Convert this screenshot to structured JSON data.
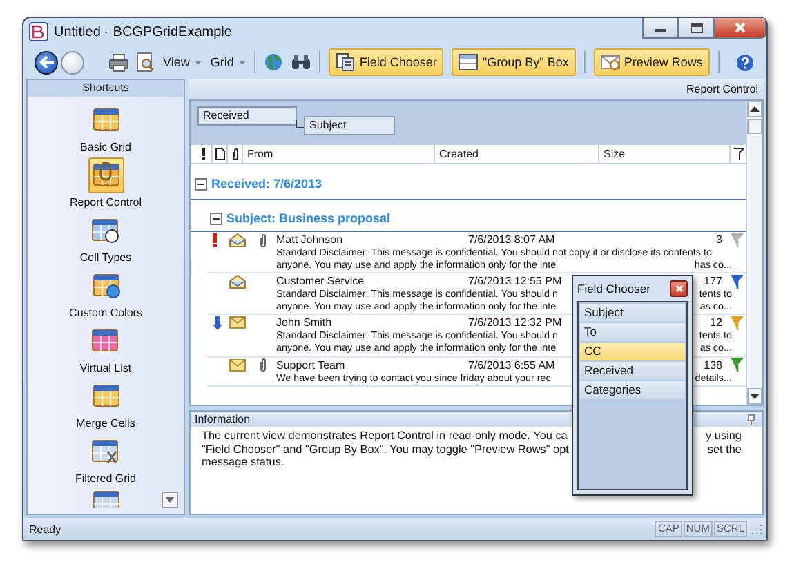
{
  "window": {
    "title": "Untitled - BCGPGridExample"
  },
  "toolbar": {
    "menus": [
      "View",
      "Grid"
    ],
    "toggles": [
      {
        "label": "Field Chooser",
        "checked": true
      },
      {
        "label": "\"Group By\" Box",
        "checked": true
      },
      {
        "label": "Preview Rows",
        "checked": true
      }
    ]
  },
  "sidebar": {
    "title": "Shortcuts",
    "items": [
      {
        "label": "Basic Grid",
        "selected": false
      },
      {
        "label": "Report Control",
        "selected": true
      },
      {
        "label": "Cell Types",
        "selected": false
      },
      {
        "label": "Custom Colors",
        "selected": false
      },
      {
        "label": "Virtual List",
        "selected": false
      },
      {
        "label": "Merge Cells",
        "selected": false
      },
      {
        "label": "Filtered Grid",
        "selected": false
      }
    ]
  },
  "report": {
    "title": "Report Control",
    "group_by": [
      "Received",
      "Subject"
    ],
    "columns": [
      "From",
      "Created",
      "Size"
    ],
    "groups": [
      {
        "label": "Received: 7/6/2013",
        "expanded": true,
        "children": [
          {
            "label": "Subject: Business proposal",
            "expanded": true,
            "rows": [
              {
                "high_importance": true,
                "low_importance": false,
                "read": true,
                "attachment": true,
                "from": "Matt Johnson",
                "created": "7/6/2013 8:07 AM",
                "size": "3",
                "color": "#b4b4b4",
                "preview": [
                  {
                    "left": "Standard Disclaimer: This message is confidential. You should not copy it or disclose its contents to"
                  },
                  {
                    "left": "anyone. You may use and apply the information only for the inte",
                    "right": "has co..."
                  }
                ]
              },
              {
                "high_importance": false,
                "low_importance": false,
                "read": true,
                "attachment": false,
                "from": "Customer Service",
                "created": "7/6/2013 12:55 PM",
                "size": "177",
                "color": "#2a5fd0",
                "preview": [
                  {
                    "left": "Standard Disclaimer: This message is confidential. You should n",
                    "right": "tents to"
                  },
                  {
                    "left": "anyone. You may use and apply the information only for the inte",
                    "right": "as co..."
                  }
                ]
              },
              {
                "high_importance": false,
                "low_importance": true,
                "read": false,
                "attachment": false,
                "from": "John Smith",
                "created": "7/6/2013 12:32 PM",
                "size": "12",
                "color": "#e0a020",
                "preview": [
                  {
                    "left": "Standard Disclaimer: This message is confidential. You should n",
                    "right": "tents to"
                  },
                  {
                    "left": "anyone. You may use and apply the information only for the inte",
                    "right": "as co..."
                  }
                ]
              },
              {
                "high_importance": false,
                "low_importance": false,
                "read": false,
                "attachment": true,
                "from": "Support Team",
                "created": "7/6/2013 6:55 AM",
                "size": "138",
                "color": "#3a9a2a",
                "preview": [
                  {
                    "left": "We have been trying to contact you since friday about your rec",
                    "right": "details..."
                  }
                ]
              }
            ]
          }
        ]
      }
    ]
  },
  "information": {
    "title": "Information",
    "lines": [
      {
        "left": "The current view demonstrates Report Control in read-only mode. You ca",
        "right": "y using"
      },
      {
        "left": "\"Field Chooser\" and \"Group By Box\".  You may toggle \"Preview Rows\" opt",
        "right": "set the"
      },
      {
        "left": "message status."
      }
    ]
  },
  "field_chooser": {
    "title": "Field Chooser",
    "fields": [
      {
        "label": "Subject",
        "selected": false
      },
      {
        "label": "To",
        "selected": false
      },
      {
        "label": "CC",
        "selected": true
      },
      {
        "label": "Received",
        "selected": false
      },
      {
        "label": "Categories",
        "selected": false
      }
    ]
  },
  "status_bar": {
    "text": "Ready",
    "indicators": [
      "CAP",
      "NUM",
      "SCRL"
    ]
  }
}
